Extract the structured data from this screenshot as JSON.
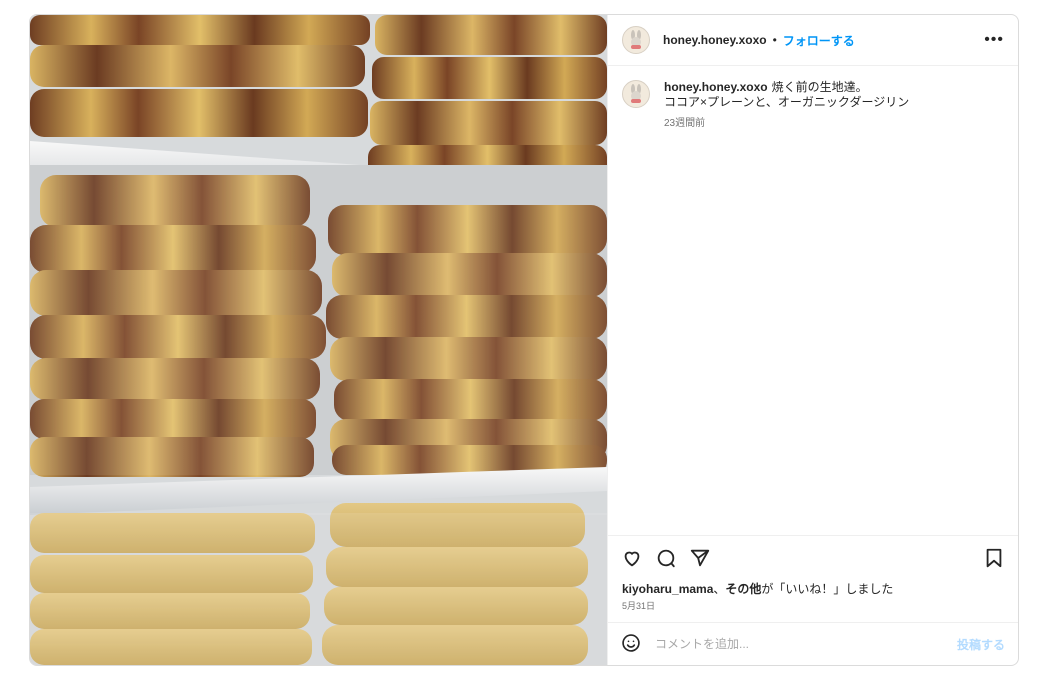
{
  "post": {
    "username": "honey.honey.xoxo",
    "separator": "•",
    "follow_label": "フォローする",
    "more_icon": "more-horizontal-icon",
    "image_alt": "photo-of-wrapped-cookie-dough-logs-in-freezer"
  },
  "caption": {
    "username": "honey.honey.xoxo",
    "line1": "焼く前の生地達。",
    "line2": "ココア×プレーンと、オーガニックダージリン",
    "time": "23週間前"
  },
  "actions": {
    "like_icon": "heart-icon",
    "comment_icon": "comment-icon",
    "share_icon": "share-icon",
    "save_icon": "bookmark-icon"
  },
  "likes": {
    "user": "kiyoharu_mama",
    "joiner": "、",
    "others": "その他",
    "suffix": "が「いいね！」しました"
  },
  "date": "5月31日",
  "comment_box": {
    "emoji_icon": "emoji-icon",
    "placeholder": "コメントを追加...",
    "post_label": "投稿する"
  },
  "colors": {
    "accent": "#0095f6",
    "post_disabled": "#b3dbff",
    "border": "#dbdbdb"
  }
}
